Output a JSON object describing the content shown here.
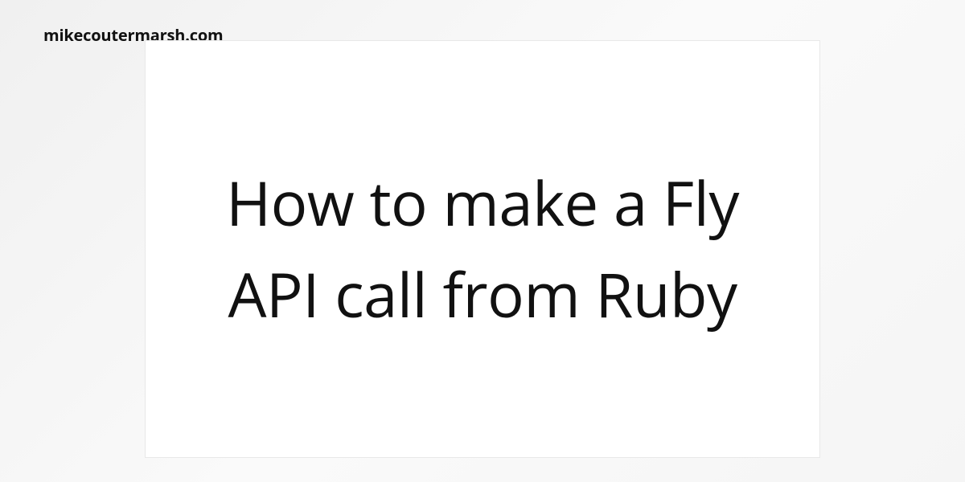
{
  "header": {
    "site_name": "mikecoutermarsh.com"
  },
  "card": {
    "title": "How to make a Fly API call from Ruby"
  }
}
